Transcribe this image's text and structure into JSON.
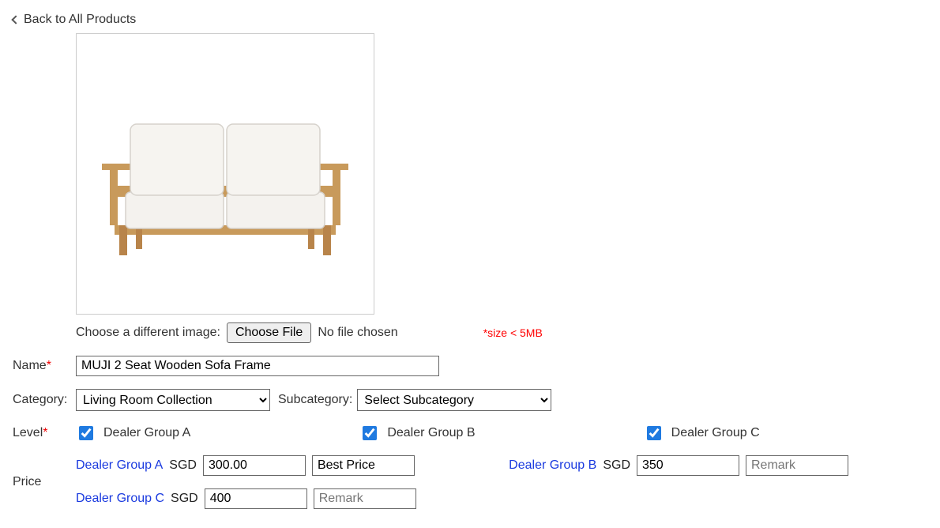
{
  "nav": {
    "back_label": "Back to All Products"
  },
  "image": {
    "choose_label": "Choose a different image:",
    "button": "Choose File",
    "status": "No file chosen",
    "size_note": "*size < 5MB"
  },
  "fields": {
    "name_label": "Name",
    "name_value": "MUJI 2 Seat Wooden Sofa Frame",
    "category_label": "Category:",
    "category_value": "Living Room Collection",
    "subcategory_label": "Subcategory:",
    "subcategory_value": "Select Subcategory",
    "level_label": "Level",
    "price_label": "Price"
  },
  "levels": {
    "a": "Dealer Group A",
    "b": "Dealer Group B",
    "c": "Dealer Group C"
  },
  "currency": "SGD",
  "prices": {
    "a": {
      "name": "Dealer Group A",
      "price": "300.00",
      "remark": "Best Price"
    },
    "b": {
      "name": "Dealer Group B",
      "price": "350",
      "remark": "",
      "remark_placeholder": "Remark"
    },
    "c": {
      "name": "Dealer Group C",
      "price": "400",
      "remark": "",
      "remark_placeholder": "Remark"
    }
  }
}
